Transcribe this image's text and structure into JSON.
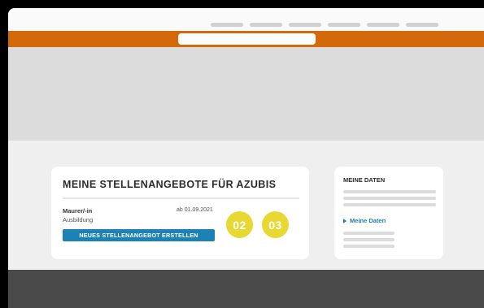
{
  "header": {
    "nav_items": [
      "",
      "",
      "",
      "",
      "",
      ""
    ]
  },
  "main_card": {
    "title": "MEINE STELLENANGEBOTE FÜR AZUBIS",
    "job": {
      "title": "Maurer/-in",
      "type": "Ausbildung",
      "date": "ab 01.09.2021"
    },
    "create_button_label": "NEUES STELLENANGEBOT ERSTELLEN",
    "badges": [
      "02",
      "03"
    ]
  },
  "side_card": {
    "title": "MEINE DATEN",
    "link_label": "Meine Daten"
  },
  "colors": {
    "accent_orange": "#d3690a",
    "link_blue": "#1c82b6",
    "badge_yellow": "#e8d832",
    "footer_gray": "#4a4a4a"
  }
}
